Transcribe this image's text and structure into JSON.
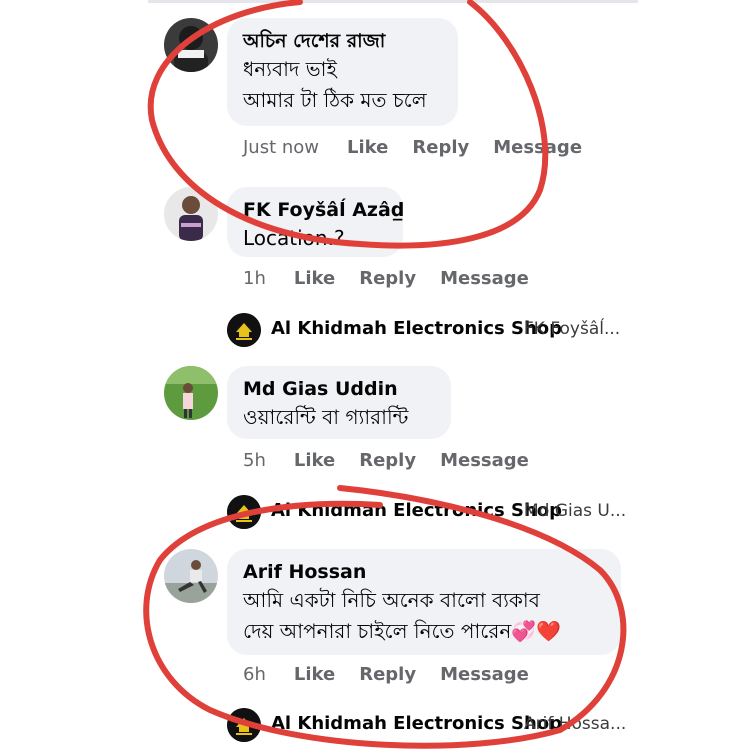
{
  "comments": [
    {
      "author": "অচিন দেশের রাজা",
      "lines": [
        "ধন্যবাদ ভাই",
        "আমার টা ঠিক মত চলে"
      ],
      "time": "Just now",
      "like": "Like",
      "reply": "Reply",
      "message": "Message"
    },
    {
      "author": "FK Foyšâĺ Azâd̲",
      "lines": [
        "Location.?"
      ],
      "time": "1h",
      "like": "Like",
      "reply": "Reply",
      "message": "Message"
    },
    {
      "author": "Md Gias Uddin",
      "lines": [
        "ওয়ারেন্টি বা গ্যারান্টি"
      ],
      "time": "5h",
      "like": "Like",
      "reply": "Reply",
      "message": "Message"
    },
    {
      "author": "Arif Hossan",
      "lines": [
        "আমি একটা নিচি  অনেক বালো ব্যকাব",
        "দেয় আপনারা চাইলে নিতে পারেন💞❤️"
      ],
      "time": "6h",
      "like": "Like",
      "reply": "Reply",
      "message": "Message"
    }
  ],
  "page_replies": [
    {
      "page": "Al Khidmah Electronics Shop",
      "snippet": "FK Foyšâĺ..."
    },
    {
      "page": "Al Khidmah Electronics Shop",
      "snippet": "Md Gias U..."
    },
    {
      "page": "Al Khidmah Electronics Shop",
      "snippet": "Arif Hossa..."
    }
  ],
  "colors": {
    "bubble": "#f0f2f5",
    "meta": "#65676b",
    "ink": "#e0403a"
  }
}
